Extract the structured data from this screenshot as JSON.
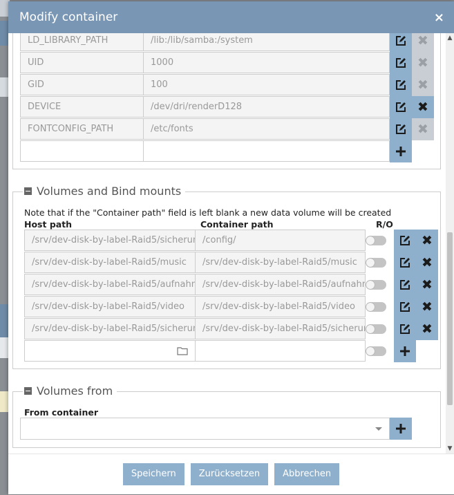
{
  "dialog": {
    "title": "Modify container",
    "close_symbol": "×"
  },
  "env_vars": {
    "rows": [
      {
        "name": "LD_LIBRARY_PATH",
        "value": "/lib:/lib/samba:/system",
        "delete_enabled": false
      },
      {
        "name": "UID",
        "value": "1000",
        "delete_enabled": false
      },
      {
        "name": "GID",
        "value": "100",
        "delete_enabled": false
      },
      {
        "name": "DEVICE",
        "value": "/dev/dri/renderD128",
        "delete_enabled": true
      },
      {
        "name": "FONTCONFIG_PATH",
        "value": "/etc/fonts",
        "delete_enabled": false
      }
    ]
  },
  "volumes": {
    "title": "Volumes and Bind mounts",
    "note": "Note that if the \"Container path\" field is left blank a new data volume will be created",
    "col_host": "Host path",
    "col_container": "Container path",
    "col_ro": "R/O",
    "rows": [
      {
        "host": "/srv/dev-disk-by-label-Raid5/sicherun",
        "container": "/config/",
        "ro": false
      },
      {
        "host": "/srv/dev-disk-by-label-Raid5/music",
        "container": "/srv/dev-disk-by-label-Raid5/music",
        "ro": false
      },
      {
        "host": "/srv/dev-disk-by-label-Raid5/aufnahm",
        "container": "/srv/dev-disk-by-label-Raid5/aufnahm",
        "ro": false
      },
      {
        "host": "/srv/dev-disk-by-label-Raid5/video",
        "container": "/srv/dev-disk-by-label-Raid5/video",
        "ro": false
      },
      {
        "host": "/srv/dev-disk-by-label-Raid5/sicherun",
        "container": "/srv/dev-disk-by-label-Raid5/sicherun",
        "ro": false
      }
    ]
  },
  "volumes_from": {
    "title": "Volumes from",
    "label": "From container",
    "selected": ""
  },
  "footer": {
    "save": "Speichern",
    "reset": "Zurücksetzen",
    "cancel": "Abbrechen"
  },
  "icons": {
    "edit": "edit-icon",
    "delete": "delete-icon",
    "add": "add-icon",
    "folder": "folder-icon"
  },
  "colors": {
    "titlebar": "#7996b4",
    "button": "#8fb0cc",
    "button_disabled": "#c8ced4"
  }
}
